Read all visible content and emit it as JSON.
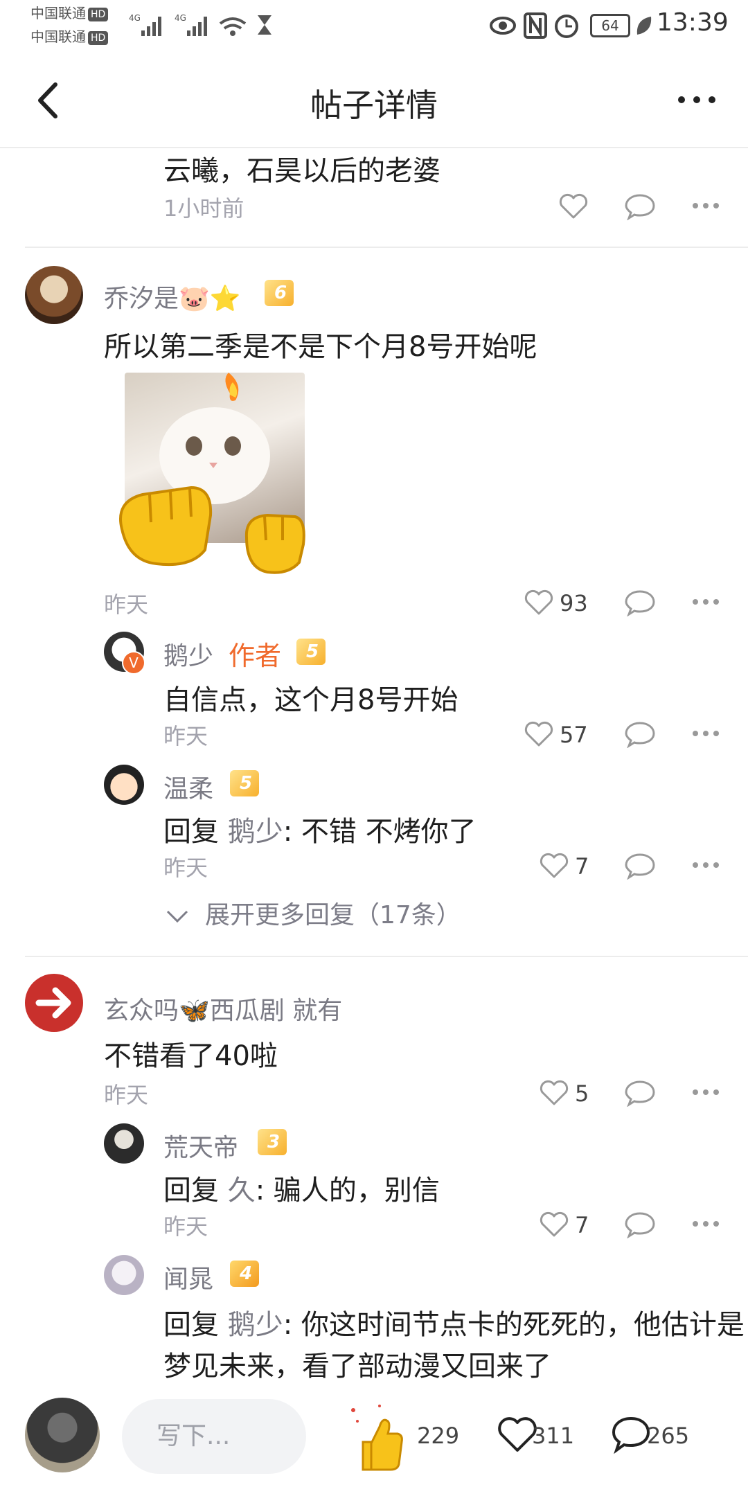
{
  "status_bar": {
    "carrier1": "中国联通",
    "carrier2": "中国联通",
    "hd": "HD",
    "battery": "64",
    "time": "13:39"
  },
  "header": {
    "title": "帖子详情"
  },
  "prev_reply": {
    "text": "云曦，石昊以后的老婆",
    "time": "1小时前"
  },
  "comments": [
    {
      "user": "乔汐是🐷⭐",
      "level": "6",
      "text": "所以第二季是不是下个月8号开始呢",
      "time": "昨天",
      "likes": "93",
      "replies": [
        {
          "user": "鹅少",
          "author_tag": "作者",
          "level": "5",
          "text": "自信点，这个月8号开始",
          "time": "昨天",
          "likes": "57"
        },
        {
          "user": "温柔",
          "level": "5",
          "reply_prefix": "回复",
          "reply_to": "鹅少",
          "text": ": 不错 不烤你了",
          "time": "昨天",
          "likes": "7"
        }
      ],
      "expand": "展开更多回复（17条）"
    },
    {
      "user": "玄众吗🦋西瓜剧 就有",
      "text": "不错看了40啦",
      "time": "昨天",
      "likes": "5",
      "replies": [
        {
          "user": "荒天帝",
          "level": "3",
          "reply_prefix": "回复",
          "reply_to": "久",
          "text": ": 骗人的，别信",
          "time": "昨天",
          "likes": "7"
        },
        {
          "user": "闻晁",
          "level": "4",
          "reply_prefix": "回复",
          "reply_to": "鹅少",
          "text": ": 你这时间节点卡的死死的，他估计是",
          "text2": "梦见未来，看了部动漫又回来了"
        }
      ]
    }
  ],
  "bottom": {
    "placeholder": "写下...",
    "thumbs": "229",
    "likes": "311",
    "comments": "265"
  },
  "colors": {
    "author": "#f06a2c",
    "badge": "#f7b02d",
    "accent_red": "#c9302c"
  }
}
